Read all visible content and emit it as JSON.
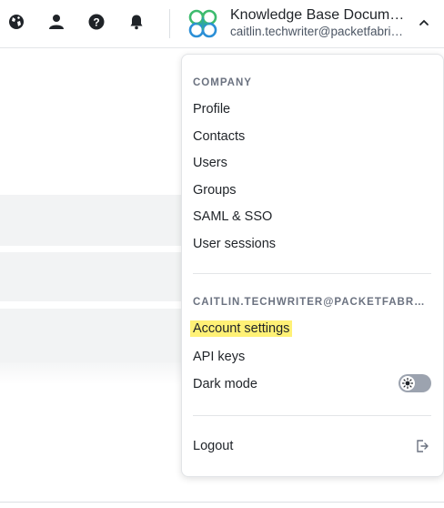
{
  "header": {
    "icons": [
      "globe-icon",
      "user-icon",
      "help-icon",
      "bell-icon"
    ],
    "account_title": "Knowledge Base Documentation",
    "account_email": "caitlin.techwriter@packetfabric.com"
  },
  "menu": {
    "company_heading": "COMPANY",
    "company_items": [
      "Profile",
      "Contacts",
      "Users",
      "Groups",
      "SAML & SSO",
      "User sessions"
    ],
    "user_heading": "CAITLIN.TECHWRITER@PACKETFABRIC.COM",
    "user_items": {
      "account_settings": "Account settings",
      "api_keys": "API keys",
      "dark_mode": "Dark mode"
    },
    "dark_mode_enabled": false,
    "logout": "Logout"
  },
  "colors": {
    "highlight": "#fff176",
    "logo_green": "#3dbb6e",
    "logo_blue": "#2b8fd6"
  }
}
